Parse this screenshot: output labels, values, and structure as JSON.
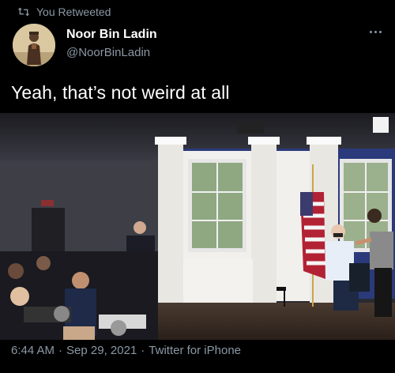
{
  "social_context": {
    "icon": "retweet-icon",
    "label": "You Retweeted"
  },
  "author": {
    "avatar": "avatar",
    "display_name": "Noor Bin Ladin",
    "handle": "@NoorBinLadin"
  },
  "more_icon": "ellipsis-icon",
  "tweet": {
    "text": "Yeah, that’s not weird at all"
  },
  "media": {
    "type": "photo",
    "alt": ""
  },
  "meta": {
    "time": "6:44 AM",
    "separator": "·",
    "date": "Sep 29, 2021",
    "source": "Twitter for iPhone"
  },
  "colors": {
    "background": "#000000",
    "primary_text": "#ffffff",
    "secondary_text": "#8b98a5"
  }
}
